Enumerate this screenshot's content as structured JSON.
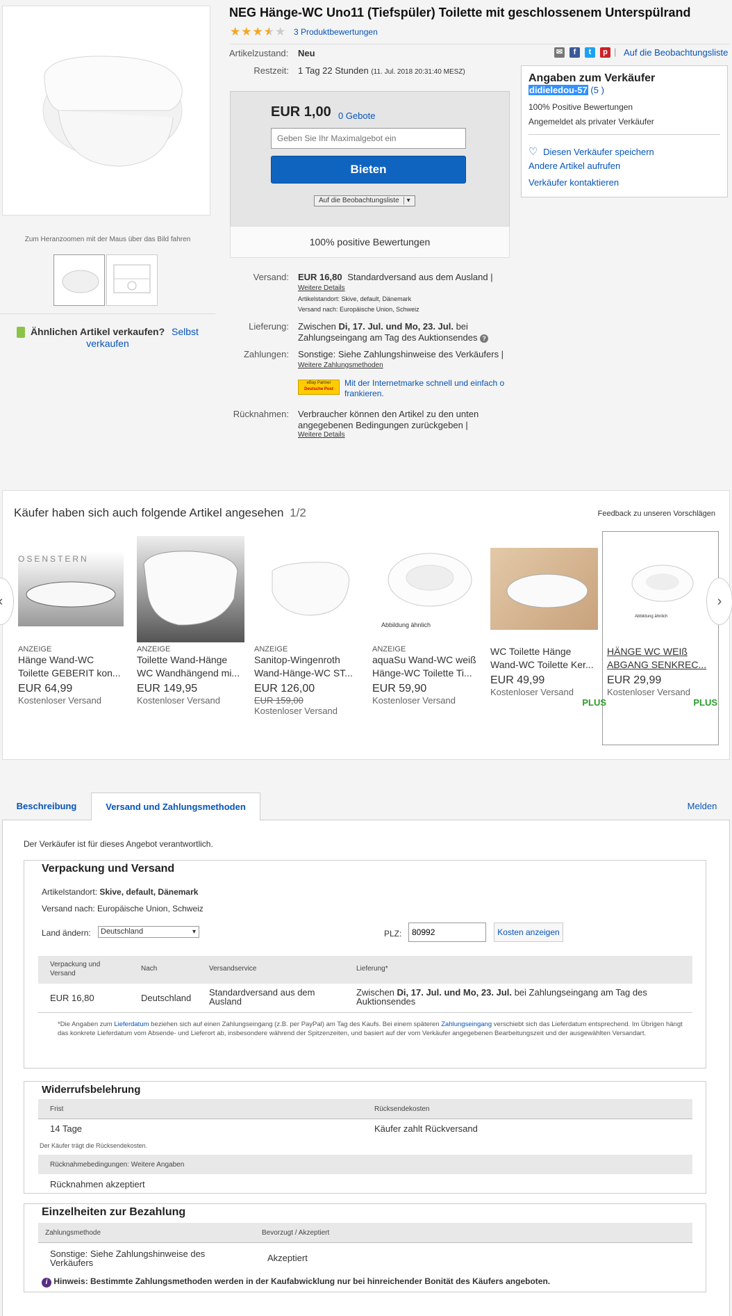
{
  "listing": {
    "title": "NEG Hänge-WC Uno11 (Tiefspüler) Toilette mit geschlossenem Unterspülrand",
    "reviews_link": "3 Produktbewertungen",
    "rating": 3.5,
    "zoom_hint": "Zum Heranzoomen mit der Maus über das Bild fahren",
    "sell_similar_label": "Ähnlichen Artikel verkaufen?",
    "sell_similar_link1": "Selbst",
    "sell_similar_link2": "verkaufen"
  },
  "share": {
    "watch_link": "Auf die Beobachtungsliste",
    "separator": "|"
  },
  "details": {
    "condition_label": "Artikelzustand:",
    "condition_value": "Neu",
    "time_label": "Restzeit:",
    "time_value": "1 Tag 22 Stunden",
    "time_detail": "(11. Jul. 2018   20:31:40 MESZ)"
  },
  "bid": {
    "price": "EUR 1,00",
    "bids": "0 Gebote",
    "input_placeholder": "Geben Sie Ihr Maximalgebot ein",
    "button": "Bieten",
    "watch_button": "Auf die Beobachtungsliste",
    "watch_arrow": "▾",
    "positive": "100% positive Bewertungen"
  },
  "seller": {
    "header": "Angaben zum Verkäufer",
    "name": "didieledou-57",
    "score": "(5 )",
    "positive": "100% Positive Bewertungen",
    "type": "Angemeldet als privater Verkäufer",
    "save": "Diesen Verkäufer speichern",
    "other_items": "Andere Artikel aufrufen",
    "contact": "Verkäufer kontaktieren"
  },
  "shipping": {
    "label": "Versand:",
    "price": "EUR 16,80",
    "service": "Standardversand aus dem Ausland |",
    "more": "Weitere Details",
    "location": "Artikelstandort:  Skive, default, Dänemark",
    "ships_to": "Versand nach:  Europäische Union, Schweiz",
    "delivery_label": "Lieferung:",
    "delivery_pre": "Zwischen ",
    "delivery_dates": "Di, 17. Jul. und Mo, 23. Jul.",
    "delivery_post": " bei",
    "delivery_line2": "Zahlungseingang am Tag des Auktionsendes",
    "payments_label": "Zahlungen:",
    "payments_value": "Sonstige: Siehe Zahlungshinweise des Verkäufers  |",
    "payments_more": "Weitere Zahlungsmethoden",
    "dp_badge_top": "eBay Partner",
    "dp_badge_bottom": "Deutsche Post",
    "dp_text1": "Mit der Internetmarke schnell und einfach o",
    "dp_text2": "frankieren.",
    "returns_label": "Rücknahmen:",
    "returns_line1": "Verbraucher können den Artikel zu den unten",
    "returns_line2": "angegebenen Bedingungen zurückgeben |",
    "returns_more": "Weitere Details"
  },
  "similar": {
    "header": "Käufer haben sich auch folgende Artikel angesehen",
    "page": "1/2",
    "feedback": "Feedback zu unseren Vorschlägen",
    "image_badge_1": "OSENSTERN",
    "image_note": "Abbildung ähnlich",
    "items": [
      {
        "ad": "ANZEIGE",
        "name": "Hänge Wand-WC Toilette GEBERIT kon...",
        "price": "EUR 64,99",
        "old": "",
        "ship": "Kostenloser Versand",
        "plus": ""
      },
      {
        "ad": "ANZEIGE",
        "name": "Toilette Wand-Hänge WC Wandhängend mi...",
        "price": "EUR 149,95",
        "old": "",
        "ship": "Kostenloser Versand",
        "plus": ""
      },
      {
        "ad": "ANZEIGE",
        "name": "Sanitop-Wingenroth Wand-Hänge-WC ST...",
        "price": "EUR 126,00",
        "old": "EUR 159,00",
        "ship": "Kostenloser Versand",
        "plus": ""
      },
      {
        "ad": "ANZEIGE",
        "name": "aquaSu Wand-WC weiß Hänge-WC Toilette Ti...",
        "price": "EUR 59,90",
        "old": "",
        "ship": "Kostenloser Versand",
        "plus": ""
      },
      {
        "ad": "",
        "name": "WC Toilette Hänge Wand-WC Toilette Ker...",
        "price": "EUR 49,99",
        "old": "",
        "ship": "Kostenloser Versand",
        "plus": "PLUS"
      },
      {
        "ad": "",
        "name": "HÄNGE WC WEIß ABGANG SENKREC...",
        "price": "EUR 29,99",
        "old": "",
        "ship": "Kostenloser Versand",
        "plus": "PLUS"
      }
    ]
  },
  "tabs": {
    "t1": "Beschreibung",
    "t2": "Versand und Zahlungsmethoden",
    "report": "Melden"
  },
  "desc": {
    "responsible": "Der Verkäufer ist für dieses Angebot verantwortlich.",
    "pack_title": "Verpackung und Versand",
    "loc_label": "Artikelstandort: ",
    "loc_value": "Skive, default, Dänemark",
    "ship_to": "Versand nach: Europäische Union, Schweiz",
    "country_label": "Land ändern:",
    "country_value": "Deutschland",
    "country_arrow": "▾",
    "plz_label": "PLZ:",
    "plz_value": "80992",
    "cost_button": "Kosten anzeigen",
    "th": [
      "Verpackung und Versand",
      "Nach",
      "Versandservice",
      "Lieferung*"
    ],
    "row": [
      "EUR 16,80",
      "Deutschland",
      "Standardversand aus dem Ausland"
    ],
    "row_delivery_pre": "Zwischen ",
    "row_delivery_dates": "Di, 17. Jul. und Mo, 23. Jul.",
    "row_delivery_post": " bei Zahlungseingang am Tag des Auktionsendes",
    "fn_1": "*Die Angaben zum ",
    "fn_link1": "Lieferdatum",
    "fn_2": " beziehen sich auf einen Zahlungseingang (z.B. per PayPal) am Tag des Kaufs. Bei einem späteren ",
    "fn_link2": "Zahlungseingang",
    "fn_3": " verschiebt sich das Lieferdatum entsprechend. Im Übrigen hängt das konkrete Lieferdatum vom Absende- und Lieferort ab, insbesondere während der Spitzenzeiten, und basiert auf der vom Verkäufer angegebenen Bearbeitungszeit und der ausgewählten Versandart.",
    "withdraw_title": "Widerrufsbelehrung",
    "w_th1": "Frist",
    "w_th2": "Rücksendekosten",
    "w_val1": "14 Tage",
    "w_val2": "Käufer zahlt Rückversand",
    "w_note": "Der Käufer trägt die Rücksendekosten.",
    "w_cond": "Rücknahmebedingungen: Weitere Angaben",
    "w_accept": "Rücknahmen akzeptiert",
    "pay_title": "Einzelheiten zur Bezahlung",
    "p_th1": "Zahlungsmethode",
    "p_th2": "Bevorzugt / Akzeptiert",
    "p_val1a": "Sonstige: Siehe Zahlungshinweise des",
    "p_val1b": "Verkäufers",
    "p_val2": "Akzeptiert",
    "p_info": "Hinweis: Bestimmte Zahlungsmethoden werden in der Kaufabwicklung nur bei hinreichender Bonität des Käufers angeboten."
  },
  "colors": {
    "link": "#0654ba",
    "bid_button": "#0f64c0",
    "star": "#f5a623",
    "plus": "#2c9c2c"
  }
}
